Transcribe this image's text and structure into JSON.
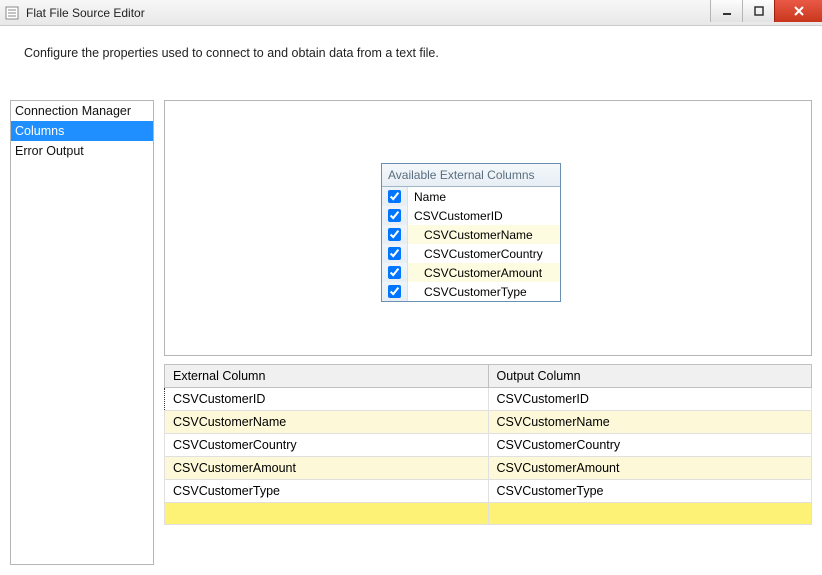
{
  "window": {
    "title": "Flat File Source Editor"
  },
  "description": "Configure the properties used to connect to and obtain data from a text file.",
  "sidebar": {
    "items": [
      {
        "label": "Connection Manager",
        "selected": false
      },
      {
        "label": "Columns",
        "selected": true
      },
      {
        "label": "Error Output",
        "selected": false
      }
    ]
  },
  "available": {
    "header": "Available External Columns",
    "rows": [
      {
        "label": "Name",
        "checked": true,
        "indent": false,
        "alt": false
      },
      {
        "label": "CSVCustomerID",
        "checked": true,
        "indent": false,
        "alt": false
      },
      {
        "label": "CSVCustomerName",
        "checked": true,
        "indent": true,
        "alt": true
      },
      {
        "label": "CSVCustomerCountry",
        "checked": true,
        "indent": true,
        "alt": false
      },
      {
        "label": "CSVCustomerAmount",
        "checked": true,
        "indent": true,
        "alt": true
      },
      {
        "label": "CSVCustomerType",
        "checked": true,
        "indent": true,
        "alt": false
      }
    ]
  },
  "grid": {
    "headers": {
      "external": "External Column",
      "output": "Output Column"
    },
    "rows": [
      {
        "external": "CSVCustomerID",
        "output": "CSVCustomerID",
        "alt": false,
        "focus": true
      },
      {
        "external": "CSVCustomerName",
        "output": "CSVCustomerName",
        "alt": true,
        "focus": false
      },
      {
        "external": "CSVCustomerCountry",
        "output": "CSVCustomerCountry",
        "alt": false,
        "focus": false
      },
      {
        "external": "CSVCustomerAmount",
        "output": "CSVCustomerAmount",
        "alt": true,
        "focus": false
      },
      {
        "external": "CSVCustomerType",
        "output": "CSVCustomerType",
        "alt": false,
        "focus": false
      }
    ]
  }
}
